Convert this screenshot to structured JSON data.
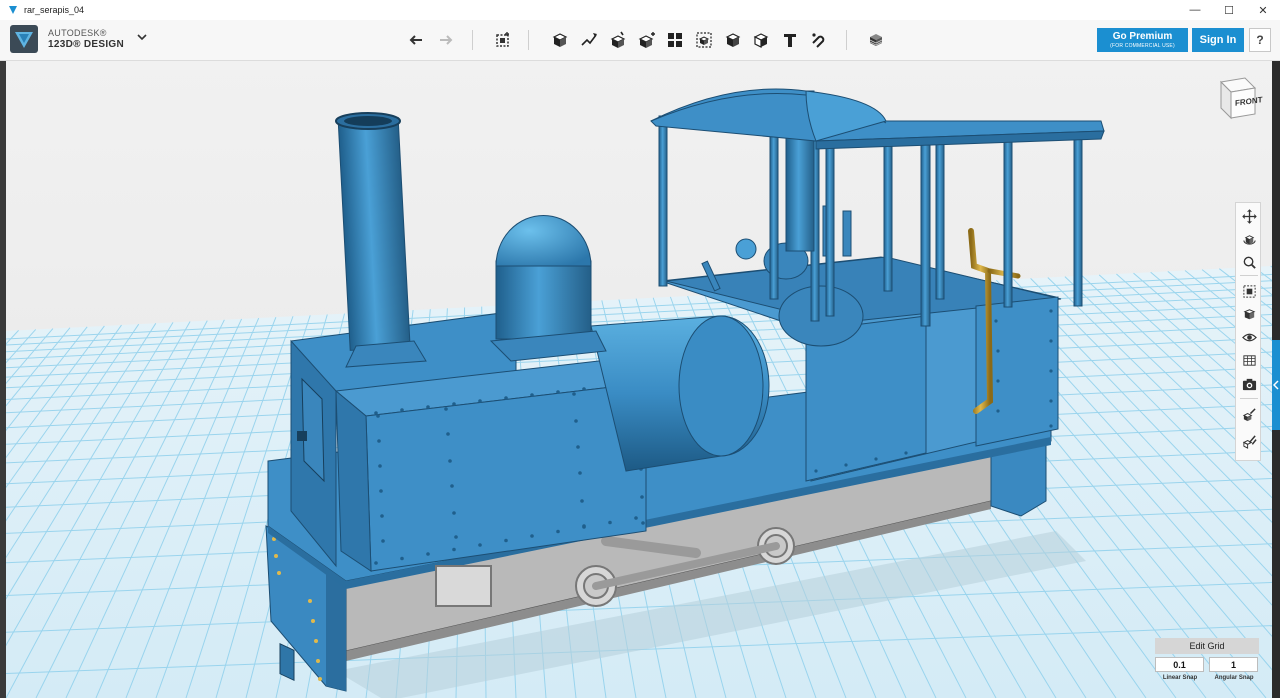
{
  "window": {
    "title": "rar_serapis_04",
    "controls": {
      "minimize": "—",
      "maximize": "☐",
      "close": "✕"
    }
  },
  "brand": {
    "line1": "AUTODESK®",
    "line2": "123D® DESIGN",
    "logo_icon": "autodesk-123d-logo"
  },
  "toolbar": {
    "tools": [
      {
        "name": "undo-icon"
      },
      {
        "name": "redo-icon"
      },
      {
        "name": "transform-icon"
      },
      {
        "name": "primitives-icon"
      },
      {
        "name": "sketch-icon"
      },
      {
        "name": "construct-icon"
      },
      {
        "name": "modify-icon"
      },
      {
        "name": "pattern-icon"
      },
      {
        "name": "group-icon"
      },
      {
        "name": "combine-icon"
      },
      {
        "name": "measure-icon"
      },
      {
        "name": "text-icon"
      },
      {
        "name": "snap-icon"
      },
      {
        "name": "material-icon"
      }
    ]
  },
  "premium": {
    "main": "Go Premium",
    "sub": "(FOR COMMERCIAL USE)"
  },
  "signin": {
    "label": "Sign In"
  },
  "help": {
    "label": "?"
  },
  "viewcube": {
    "face": "FRONT"
  },
  "navbar": {
    "tools": [
      "pan-icon",
      "orbit-icon",
      "zoom-icon",
      "fit-icon",
      "views-icon",
      "visibility-icon",
      "materials-icon",
      "screenshot-icon",
      "edit-icon",
      "edit-multi-icon"
    ]
  },
  "grid": {
    "edit_label": "Edit Grid",
    "linear_snap_value": "0.1",
    "angular_snap_value": "1",
    "linear_snap_label": "Linear Snap",
    "angular_snap_label": "Angular Snap"
  },
  "colors": {
    "accent": "#1b8fd1",
    "model_blue": "#3e8fc7",
    "model_blue_dark": "#1f5f8c",
    "brass": "#c8a13a",
    "chassis_gray": "#b8b8b8",
    "grid_line": "#7fc6e6",
    "grid_floor": "#dbeef7"
  }
}
